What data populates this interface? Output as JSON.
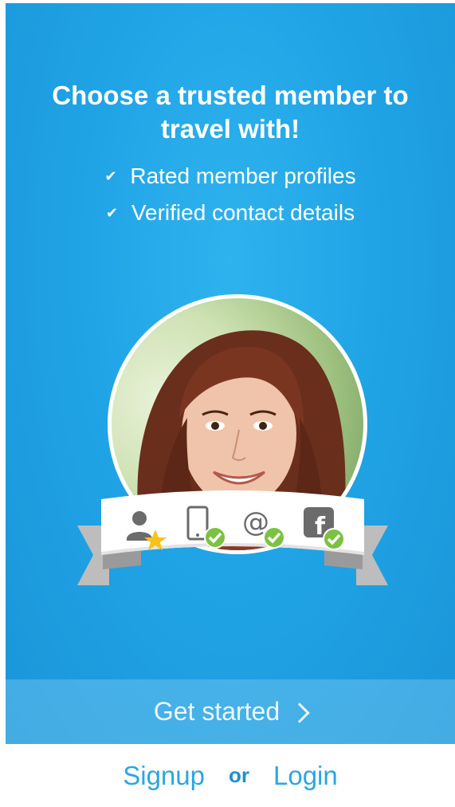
{
  "hero": {
    "headline_line1": "Choose a trusted member to",
    "headline_line2": "travel with!",
    "features": [
      {
        "icon": "checkmark-icon",
        "label": "Rated member profiles"
      },
      {
        "icon": "checkmark-icon",
        "label": "Verified contact details"
      }
    ]
  },
  "badge": {
    "icons": [
      "member-rating-icon",
      "phone-verified-icon",
      "email-verified-icon",
      "facebook-verified-icon"
    ]
  },
  "cta": {
    "label": "Get started"
  },
  "auth": {
    "signup_label": "Signup",
    "or_label": "or",
    "login_label": "Login"
  },
  "colors": {
    "hero_blue": "#20a4e6",
    "link_blue": "#2ba6e3",
    "check_green": "#7cc242",
    "star_yellow": "#f7c21a",
    "icon_gray": "#6b6b6b"
  }
}
